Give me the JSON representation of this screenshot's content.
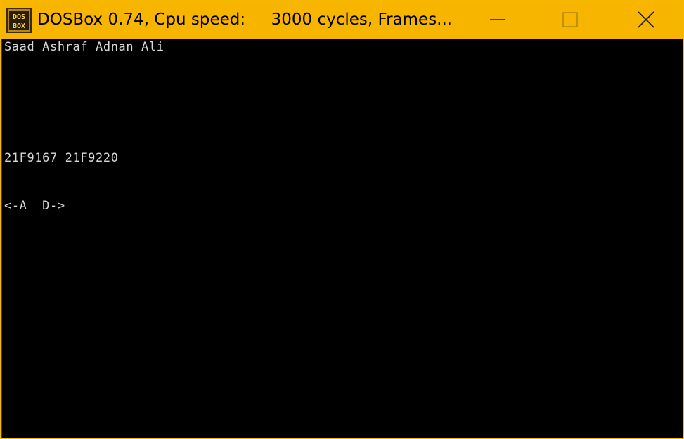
{
  "window": {
    "title": "DOSBox 0.74, Cpu speed:     3000 cycles, Frames...",
    "icon": "dosbox-icon",
    "controls": {
      "minimize": "minimize-icon",
      "maximize": "maximize-icon",
      "close": "close-icon"
    },
    "accent_color": "#f7b500"
  },
  "screen": {
    "lines": {
      "names": "Saad Ashraf Adnan Ali",
      "ids": "21F9167 21F9220",
      "keys": "<-A  D->"
    },
    "text_color": "#d8d8d8",
    "background_color": "#000000"
  }
}
